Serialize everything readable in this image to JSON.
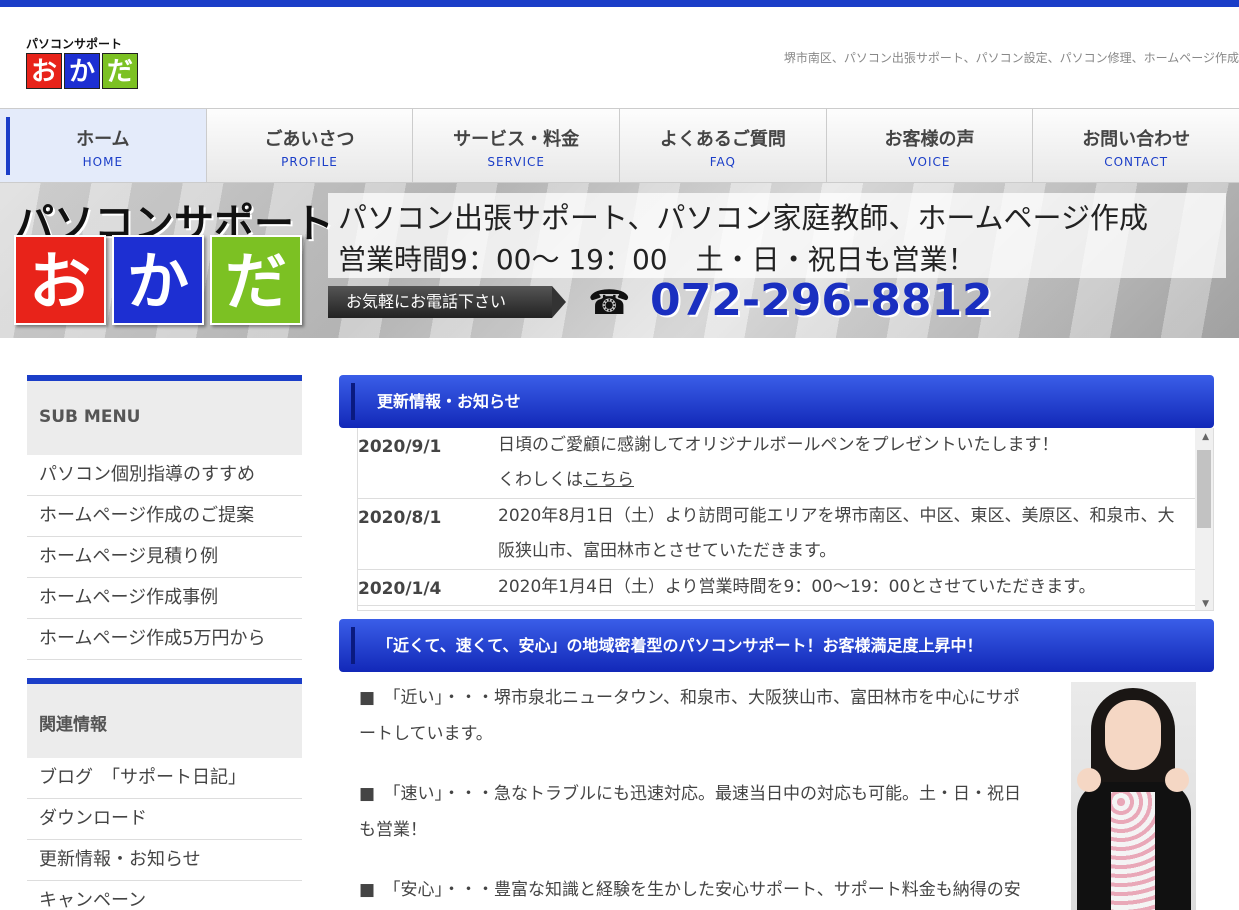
{
  "header": {
    "logo_top": "パソコンサポート",
    "logo_chars": [
      "お",
      "か",
      "だ"
    ],
    "tagline": "堺市南区、パソコン出張サポート、パソコン設定、パソコン修理、ホームページ作成"
  },
  "nav": [
    {
      "jp": "ホーム",
      "en": "HOME"
    },
    {
      "jp": "ごあいさつ",
      "en": "PROFILE"
    },
    {
      "jp": "サービス・料金",
      "en": "SERVICE"
    },
    {
      "jp": "よくあるご質問",
      "en": "FAQ"
    },
    {
      "jp": "お客様の声",
      "en": "VOICE"
    },
    {
      "jp": "お問い合わせ",
      "en": "CONTACT"
    }
  ],
  "banner": {
    "logo_top": "パソコンサポート",
    "logo_chars": [
      "お",
      "か",
      "だ"
    ],
    "line1": "パソコン出張サポート、パソコン家庭教師、ホームページ作成",
    "line2": "営業時間9：00～ 19：00　土・日・祝日も営業！",
    "call": "お気軽にお電話下さい",
    "phone_icon": "☎",
    "phone": "072-296-8812"
  },
  "sidebar": {
    "sub_menu_title": "SUB MENU",
    "sub_menu": [
      "パソコン個別指導のすすめ",
      "ホームページ作成のご提案",
      "ホームページ見積り例",
      "ホームページ作成事例",
      "ホームページ作成5万円から"
    ],
    "related_title": "関連情報",
    "related": [
      "ブログ　「サポート日記」",
      "ダウンロード",
      "更新情報・お知らせ",
      "キャンペーン"
    ]
  },
  "news": {
    "title": "更新情報・お知らせ",
    "items": [
      {
        "date": "2020/9/1",
        "line1": "日頃のご愛顧に感謝してオリジナルボールペンをプレゼントいたします！",
        "line2_prefix": "くわしくは",
        "line2_link": "こちら"
      },
      {
        "date": "2020/8/1",
        "line1": "2020年8月1日（土）より訪問可能エリアを堺市南区、中区、東区、美原区、和泉市、大",
        "line2": "阪狭山市、富田林市とさせていただきます。"
      },
      {
        "date": "2020/1/4",
        "line1": "2020年1月4日（土）より営業時間を9：00～19：00とさせていただきます。"
      }
    ]
  },
  "intro": {
    "title": "「近くて、速くて、安心」の地域密着型のパソコンサポート！お客様満足度上昇中！",
    "paras": [
      {
        "l1": "■　「近い」・・・堺市泉北ニュータウン、和泉市、大阪狭山市、富田林市を中心にサポ",
        "l2": "ートしています。"
      },
      {
        "l1": "■　「速い」・・・急なトラブルにも迅速対応。最速当日中の対応も可能。土・日・祝日",
        "l2": "も営業！"
      },
      {
        "l1": "■　「安心」・・・豊富な知識と経験を生かした安心サポート、サポート料金も納得の安",
        "l2": ""
      }
    ]
  },
  "colors": {
    "accent": "#1b3ec8",
    "red": "#e8231a",
    "blue": "#1d2fd2",
    "green": "#7cc123"
  }
}
